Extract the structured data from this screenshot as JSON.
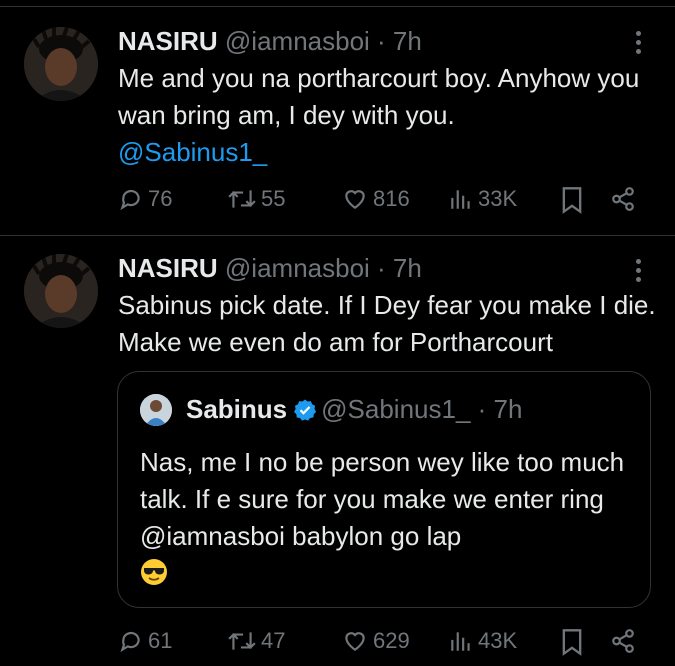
{
  "tweets": [
    {
      "name": "NASIRU",
      "handle": "@iamnasboi",
      "time": "· 7h",
      "text": "Me and you na portharcourt boy. Anyhow you wan bring am, I dey with you.",
      "mention": "@Sabinus1_",
      "stats": {
        "replies": "76",
        "retweets": "55",
        "likes": "816",
        "views": "33K"
      }
    },
    {
      "name": "NASIRU",
      "handle": "@iamnasboi",
      "time": "· 7h",
      "text": "Sabinus pick date. If I Dey fear you make I die. Make we even do am for Portharcourt",
      "quote": {
        "name": "Sabinus",
        "handle": "@Sabinus1_",
        "time": "· 7h",
        "text": "Nas, me I no be person wey like too much talk. If e sure for you make we enter ring @iamnasboi babylon go lap"
      },
      "stats": {
        "replies": "61",
        "retweets": "47",
        "likes": "629",
        "views": "43K"
      }
    }
  ],
  "colors": {
    "background": "#000000",
    "text": "#e7e9ea",
    "muted": "#71767b",
    "accent": "#1d9bf0",
    "divider": "#2f3336"
  },
  "icons": [
    "reply-icon",
    "retweet-icon",
    "like-icon",
    "views-icon",
    "bookmark-icon",
    "share-icon",
    "more-icon",
    "verified-icon",
    "sunglasses-emoji"
  ]
}
